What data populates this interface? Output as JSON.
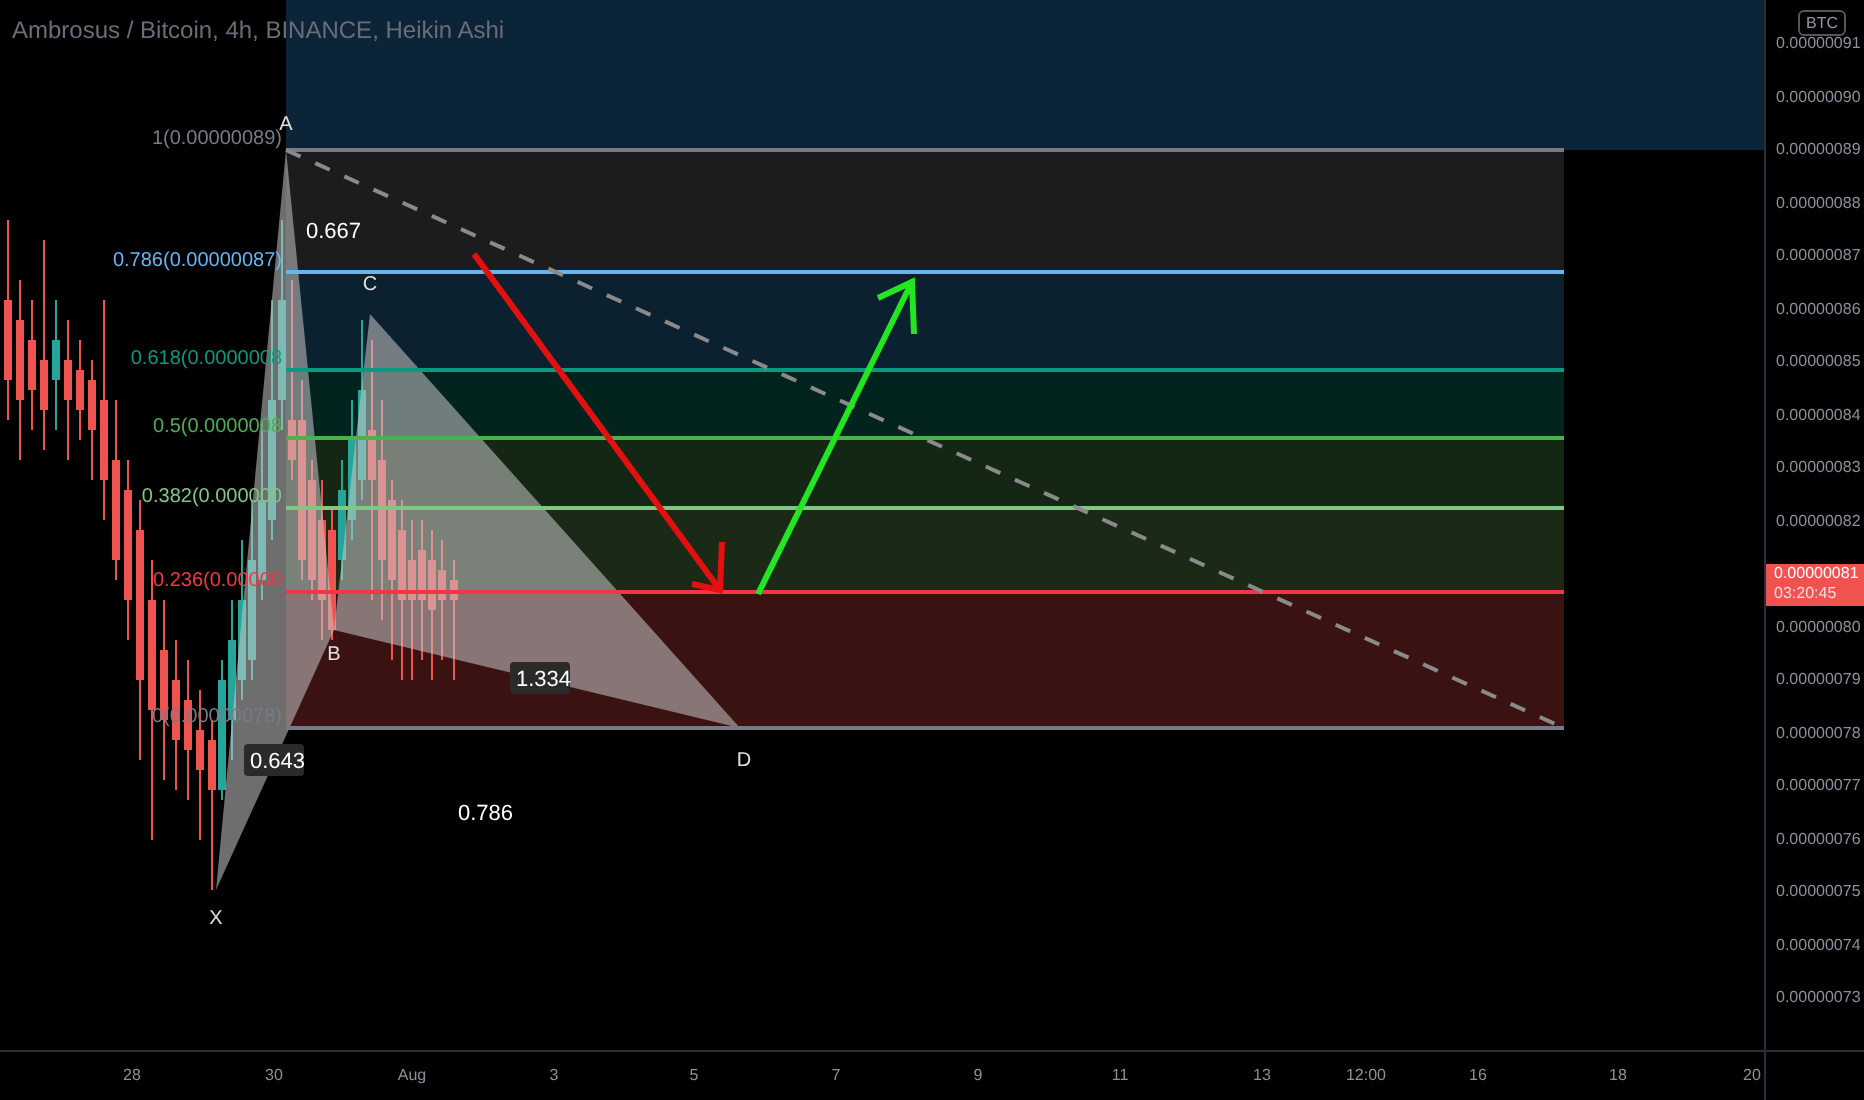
{
  "chart_title": "Ambrosus / Bitcoin, 4h, BINANCE, Heikin Ashi",
  "currency_badge": "BTC",
  "fib_levels": [
    {
      "label": "1(0.00000089)",
      "color": "#787b86"
    },
    {
      "label": "0.786(0.00000087)",
      "color": "#64b5f6"
    },
    {
      "label": "0.618(0.0000008",
      "color": "#089981"
    },
    {
      "label": "0.5(0.0000008",
      "color": "#4caf50"
    },
    {
      "label": "0.382(0.000000",
      "color": "#81c784"
    },
    {
      "label": "0.236(0.00000",
      "color": "#f23645"
    },
    {
      "label": "0(0.00000078)",
      "color": "#787b86"
    }
  ],
  "pattern_points": [
    "X",
    "A",
    "B",
    "C",
    "D"
  ],
  "ratios": [
    "0.667",
    "0.643",
    "1.334",
    "0.786"
  ],
  "price_axis": [
    "0.00000091",
    "0.00000090",
    "0.00000089",
    "0.00000088",
    "0.00000087",
    "0.00000086",
    "0.00000085",
    "0.00000084",
    "0.00000083",
    "0.00000082",
    "0.00000080",
    "0.00000079",
    "0.00000078",
    "0.00000077",
    "0.00000076",
    "0.00000075",
    "0.00000074",
    "0.00000073"
  ],
  "current_price": {
    "price": "0.00000081",
    "countdown": "03:20:45"
  },
  "time_axis": [
    "28",
    "30",
    "Aug",
    "3",
    "5",
    "7",
    "9",
    "11",
    "13",
    "12:00",
    "16",
    "18",
    "20"
  ]
}
